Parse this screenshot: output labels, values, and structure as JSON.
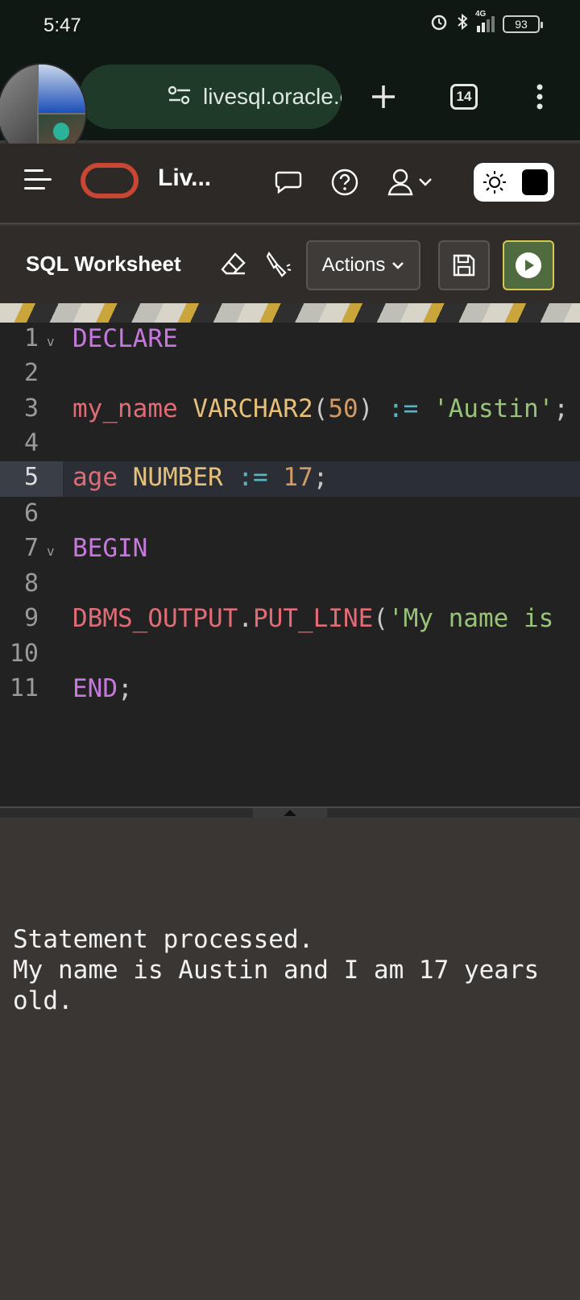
{
  "status_bar": {
    "time": "5:47",
    "network": "4G",
    "battery": "93"
  },
  "browser": {
    "url": "livesql.oracle.com/o",
    "tab_count": "14"
  },
  "header": {
    "app_title": "Liv..."
  },
  "toolbar": {
    "title": "SQL Worksheet",
    "actions_label": "Actions"
  },
  "editor": {
    "lines": [
      {
        "num": "1",
        "fold": "v"
      },
      {
        "num": "2"
      },
      {
        "num": "3"
      },
      {
        "num": "4"
      },
      {
        "num": "5"
      },
      {
        "num": "6"
      },
      {
        "num": "7",
        "fold": "v"
      },
      {
        "num": "8"
      },
      {
        "num": "9"
      },
      {
        "num": "10"
      },
      {
        "num": "11"
      }
    ],
    "tokens": {
      "l1_kw": "DECLARE",
      "l3_id": "my_name",
      "l3_ty": "VARCHAR2",
      "l3_p1": "(",
      "l3_num": "50",
      "l3_p2": ") ",
      "l3_op": ":=",
      "l3_sp": " ",
      "l3_str": "'Austin'",
      "l3_semi": ";",
      "l5_id": "age",
      "l5_ty": "NUMBER",
      "l5_op": ":=",
      "l5_num": "17",
      "l5_semi": ";",
      "l7_kw": "BEGIN",
      "l9_id1": "DBMS_OUTPUT",
      "l9_dot": ".",
      "l9_id2": "PUT_LINE",
      "l9_p": "(",
      "l9_str": "'My name is",
      "l11_kw": "END",
      "l11_semi": ";"
    },
    "active_line": "5"
  },
  "output": {
    "text": "Statement processed.\nMy name is Austin and I am 17 years old."
  },
  "colors": {
    "keyword": "#c678dd",
    "type": "#e5c07b",
    "identifier": "#e06c75",
    "string": "#98c379",
    "operator": "#56b6c2",
    "oracle_red": "#c74634",
    "run_green": "#4f6b3f"
  },
  "icons": [
    "alarm-icon",
    "bluetooth-icon",
    "signal-icon",
    "battery-icon",
    "site-settings-icon",
    "new-tab-icon",
    "tabs-icon",
    "more-icon",
    "hamburger-icon",
    "oracle-logo",
    "feedback-icon",
    "help-icon",
    "user-icon",
    "sun-icon",
    "eraser-icon",
    "format-icon",
    "chevron-down-icon",
    "save-icon",
    "run-icon"
  ]
}
